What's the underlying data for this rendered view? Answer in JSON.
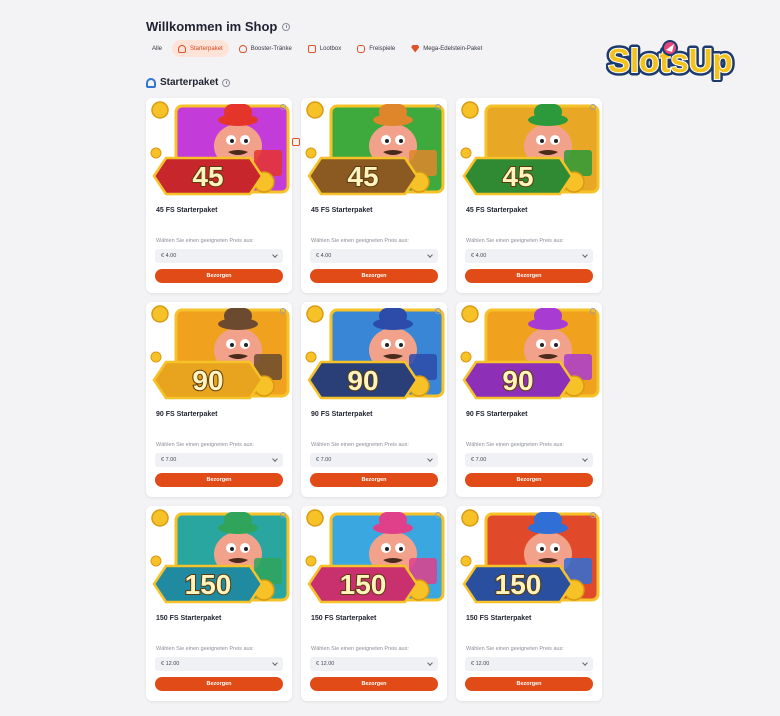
{
  "header": {
    "title": "Willkommen im Shop"
  },
  "filters": [
    {
      "label": "Alle",
      "icon": "grid-icon",
      "active": false
    },
    {
      "label": "Starterpaket",
      "icon": "user-icon",
      "active": true
    },
    {
      "label": "Booster-Tränke",
      "icon": "flask-icon",
      "active": false
    },
    {
      "label": "Lootbox",
      "icon": "box-icon",
      "active": false
    },
    {
      "label": "Freispiele",
      "icon": "game-icon",
      "active": false
    },
    {
      "label": "Mega-Edelstein-Paket",
      "icon": "gem-icon",
      "active": false
    }
  ],
  "logo": {
    "text": "SlotsUp"
  },
  "section": {
    "title": "Starterpaket"
  },
  "cards": [
    {
      "title": "45 FS Starterpaket",
      "badge": "45",
      "hint": "Wählen Sie einen geeigneten Preis aus:",
      "price": "€ 4.00",
      "button": "Bezorgen",
      "hat": "#e5352b",
      "bg": "#c33bd9",
      "plate": "#c7262c"
    },
    {
      "title": "45 FS Starterpaket",
      "badge": "45",
      "hint": "Wählen Sie einen geeigneten Preis aus:",
      "price": "€ 4.00",
      "button": "Bezorgen",
      "hat": "#e0862a",
      "bg": "#3ea93d",
      "plate": "#8a5a22"
    },
    {
      "title": "45 FS Starterpaket",
      "badge": "45",
      "hint": "Wählen Sie einen geeigneten Preis aus:",
      "price": "€ 4.00",
      "button": "Bezorgen",
      "hat": "#2c9a3a",
      "bg": "#e8a725",
      "plate": "#2f8a33"
    },
    {
      "title": "90 FS Starterpaket",
      "badge": "90",
      "hint": "Wählen Sie einen geeigneten Preis aus:",
      "price": "€ 7.00",
      "button": "Bezorgen",
      "hat": "#6b4a2f",
      "bg": "#f0a21e",
      "plate": "#e8a31f"
    },
    {
      "title": "90 FS Starterpaket",
      "badge": "90",
      "hint": "Wählen Sie einen geeigneten Preis aus:",
      "price": "€ 7.00",
      "button": "Bezorgen",
      "hat": "#2d4ba8",
      "bg": "#3a86d6",
      "plate": "#2a3f78"
    },
    {
      "title": "90 FS Starterpaket",
      "badge": "90",
      "hint": "Wählen Sie einen geeigneten Preis aus:",
      "price": "€ 7.00",
      "button": "Bezorgen",
      "hat": "#a83bd2",
      "bg": "#f0a21e",
      "plate": "#8e2fb8"
    },
    {
      "title": "150 FS Starterpaket",
      "badge": "150",
      "hint": "Wählen Sie einen geeigneten Preis aus:",
      "price": "€ 12.00",
      "button": "Bezorgen",
      "hat": "#2fa45a",
      "bg": "#2aa6a0",
      "plate": "#1f8aa0"
    },
    {
      "title": "150 FS Starterpaket",
      "badge": "150",
      "hint": "Wählen Sie einen geeigneten Preis aus:",
      "price": "€ 12.00",
      "button": "Bezorgen",
      "hat": "#e03f8a",
      "bg": "#3aa7e0",
      "plate": "#c8306e"
    },
    {
      "title": "150 FS Starterpaket",
      "badge": "150",
      "hint": "Wählen Sie einen geeigneten Preis aus:",
      "price": "€ 12.00",
      "button": "Bezorgen",
      "hat": "#2f6fd6",
      "bg": "#e04a2a",
      "plate": "#2a4f9e"
    }
  ]
}
